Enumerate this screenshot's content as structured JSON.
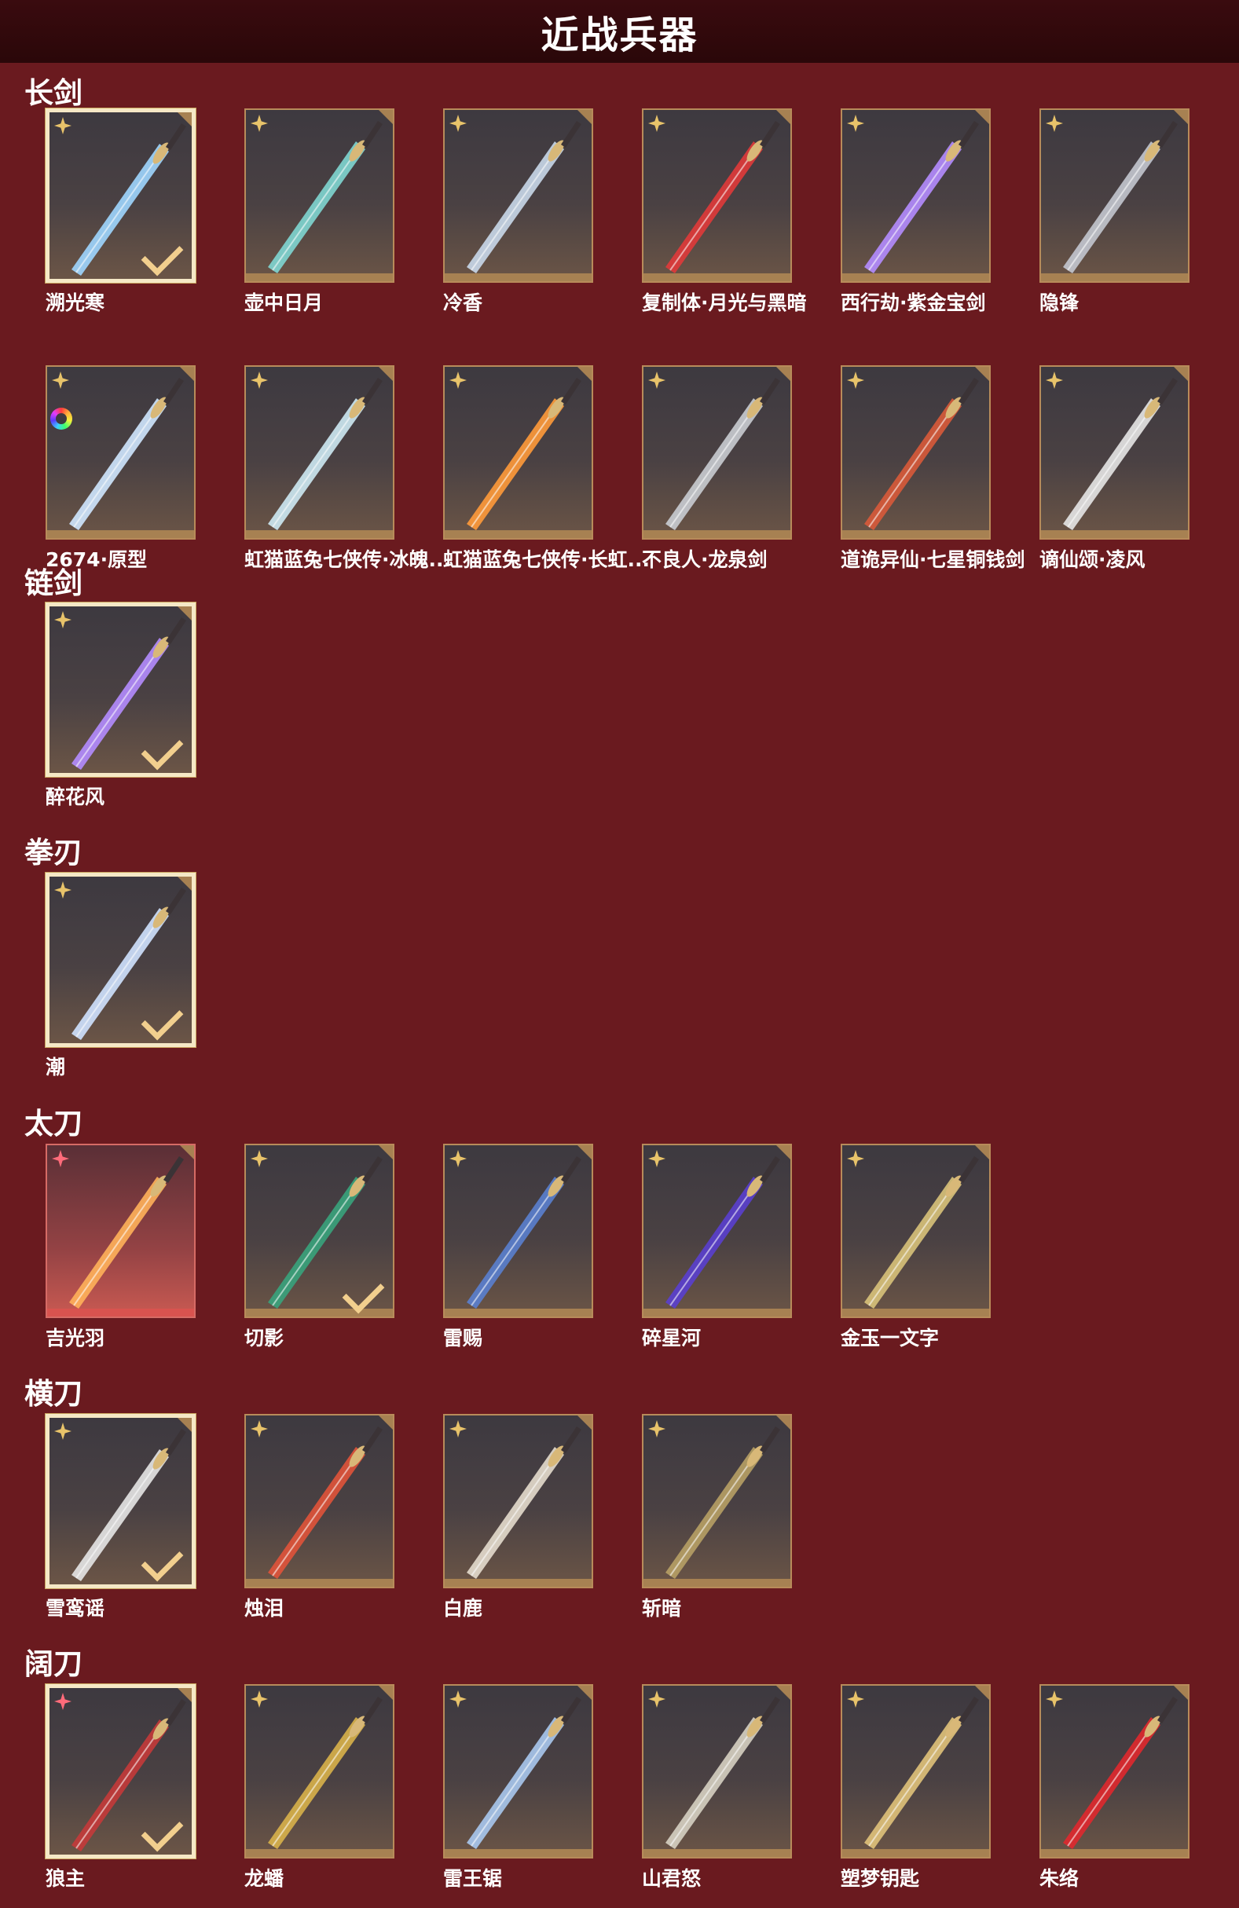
{
  "page": {
    "title": "近战兵器"
  },
  "sections": [
    {
      "id": "changjian",
      "title": "长剑",
      "items": [
        {
          "name": "溯光寒",
          "equipped": true,
          "color": "#9fd6ff"
        },
        {
          "name": "壶中日月",
          "color": "#7fd6d2"
        },
        {
          "name": "冷香",
          "color": "#c9d8ea"
        },
        {
          "name": "复制体·月光与黑暗",
          "color": "#e03a3a"
        },
        {
          "name": "西行劫·紫金宝剑",
          "color": "#b48cff"
        },
        {
          "name": "隐锋",
          "color": "#c3c7cf"
        },
        {
          "name": "2674·原型",
          "dye": true,
          "color": "#cfe7ff"
        },
        {
          "name": "虹猫蓝兔七侠传·冰魄...",
          "color": "#cde9f3"
        },
        {
          "name": "虹猫蓝兔七侠传·长虹...",
          "color": "#ff9a3a"
        },
        {
          "name": "不良人·龙泉剑",
          "color": "#c9ccd2"
        },
        {
          "name": "道诡异仙·七星铜钱剑",
          "color": "#d85a3a"
        },
        {
          "name": "谪仙颂·凌风",
          "color": "#e6e6e6"
        }
      ]
    },
    {
      "id": "lianjian",
      "title": "链剑",
      "items": [
        {
          "name": "醉花风",
          "equipped": true,
          "color": "#b48cff"
        }
      ]
    },
    {
      "id": "quandao",
      "title": "拳刃",
      "items": [
        {
          "name": "潮",
          "equipped": true,
          "color": "#cfe2ff"
        }
      ]
    },
    {
      "id": "taidao",
      "title": "太刀",
      "items": [
        {
          "name": "吉光羽",
          "red": true,
          "color": "#ffb15a"
        },
        {
          "name": "切影",
          "equipped_check": true,
          "color": "#39a37c"
        },
        {
          "name": "雷赐",
          "color": "#5a7fcf"
        },
        {
          "name": "碎星河",
          "color": "#5a3fcf"
        },
        {
          "name": "金玉一文字",
          "color": "#d8c27a"
        }
      ]
    },
    {
      "id": "hengdao",
      "title": "横刀",
      "items": [
        {
          "name": "雪鸾谣",
          "equipped": true,
          "color": "#e6e6e6"
        },
        {
          "name": "烛泪",
          "color": "#e0533a"
        },
        {
          "name": "白鹿",
          "color": "#e4dccd"
        },
        {
          "name": "斩暗",
          "color": "#b7a065"
        }
      ]
    },
    {
      "id": "kuodao",
      "title": "阔刀",
      "items": [
        {
          "name": "狼主",
          "equipped": true,
          "pink": true,
          "color": "#c43a3a"
        },
        {
          "name": "龙蟠",
          "color": "#d8b14a"
        },
        {
          "name": "雷王锯",
          "color": "#a8c8ee"
        },
        {
          "name": "山君怒",
          "color": "#d6d0c2"
        },
        {
          "name": "塑梦钥匙",
          "color": "#e0c27a"
        },
        {
          "name": "朱络",
          "color": "#e0282e"
        }
      ]
    }
  ]
}
